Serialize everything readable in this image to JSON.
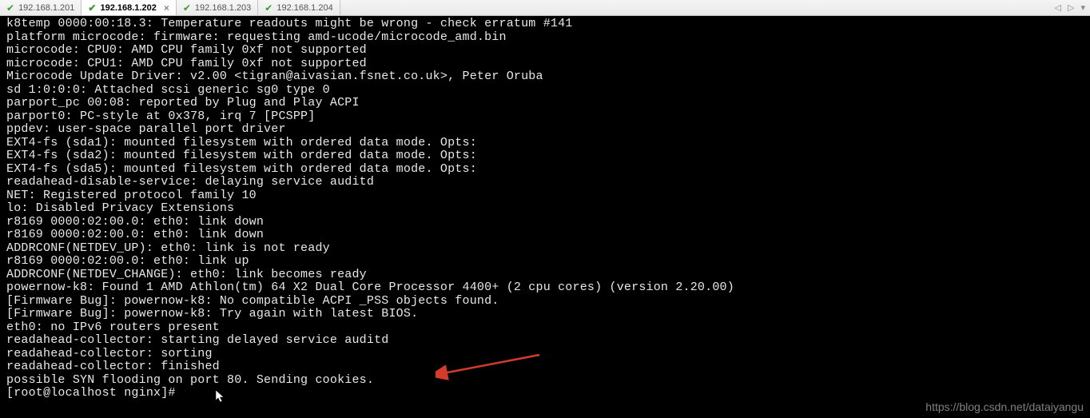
{
  "tabs": [
    {
      "label": "192.168.1.201",
      "active": false
    },
    {
      "label": "192.168.1.202",
      "active": true
    },
    {
      "label": "192.168.1.203",
      "active": false
    },
    {
      "label": "192.168.1.204",
      "active": false
    }
  ],
  "nav": {
    "prev": "◁",
    "next": "▷",
    "menu": "▾"
  },
  "terminal_lines": [
    "k8temp 0000:00:18.3: Temperature readouts might be wrong - check erratum #141",
    "platform microcode: firmware: requesting amd-ucode/microcode_amd.bin",
    "microcode: CPU0: AMD CPU family 0xf not supported",
    "microcode: CPU1: AMD CPU family 0xf not supported",
    "Microcode Update Driver: v2.00 <tigran@aivasian.fsnet.co.uk>, Peter Oruba",
    "sd 1:0:0:0: Attached scsi generic sg0 type 0",
    "parport_pc 00:08: reported by Plug and Play ACPI",
    "parport0: PC-style at 0x378, irq 7 [PCSPP]",
    "ppdev: user-space parallel port driver",
    "EXT4-fs (sda1): mounted filesystem with ordered data mode. Opts:",
    "EXT4-fs (sda2): mounted filesystem with ordered data mode. Opts:",
    "EXT4-fs (sda5): mounted filesystem with ordered data mode. Opts:",
    "readahead-disable-service: delaying service auditd",
    "NET: Registered protocol family 10",
    "lo: Disabled Privacy Extensions",
    "r8169 0000:02:00.0: eth0: link down",
    "r8169 0000:02:00.0: eth0: link down",
    "ADDRCONF(NETDEV_UP): eth0: link is not ready",
    "r8169 0000:02:00.0: eth0: link up",
    "ADDRCONF(NETDEV_CHANGE): eth0: link becomes ready",
    "powernow-k8: Found 1 AMD Athlon(tm) 64 X2 Dual Core Processor 4400+ (2 cpu cores) (version 2.20.00)",
    "[Firmware Bug]: powernow-k8: No compatible ACPI _PSS objects found.",
    "[Firmware Bug]: powernow-k8: Try again with latest BIOS.",
    "eth0: no IPv6 routers present",
    "readahead-collector: starting delayed service auditd",
    "readahead-collector: sorting",
    "readahead-collector: finished",
    "possible SYN flooding on port 80. Sending cookies.",
    "[root@localhost nginx]#"
  ],
  "watermark": "https://blog.csdn.net/dataiyangu"
}
